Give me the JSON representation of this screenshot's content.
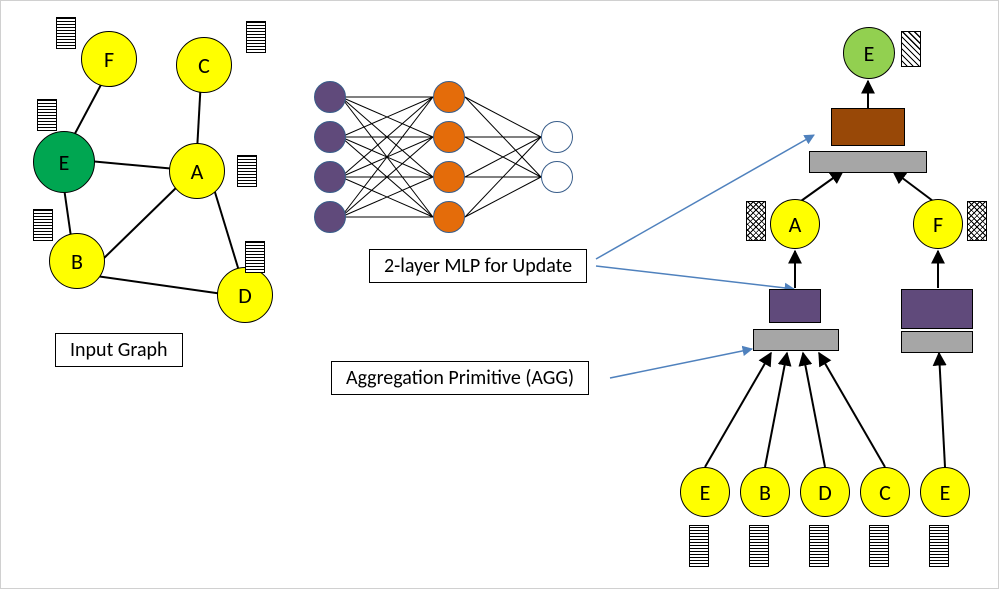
{
  "colors": {
    "yellow": "#ffff00",
    "green_dark": "#00a651",
    "green_light": "#92d050",
    "purple": "#604a7b",
    "orange": "#e46c0a",
    "orange_dark": "#984807",
    "gray": "#a6a6a6"
  },
  "input_graph": {
    "title": "Input Graph",
    "nodes": {
      "A": "A",
      "B": "B",
      "C": "C",
      "D": "D",
      "E": "E",
      "F": "F"
    }
  },
  "mlp_caption": "2-layer MLP for Update",
  "agg_caption": "Aggregation Primitive (AGG)",
  "tree": {
    "top": "E",
    "mid": {
      "A": "A",
      "F": "F"
    },
    "leaves": {
      "E": "E",
      "B": "B",
      "D": "D",
      "C": "C",
      "E2": "E"
    }
  }
}
